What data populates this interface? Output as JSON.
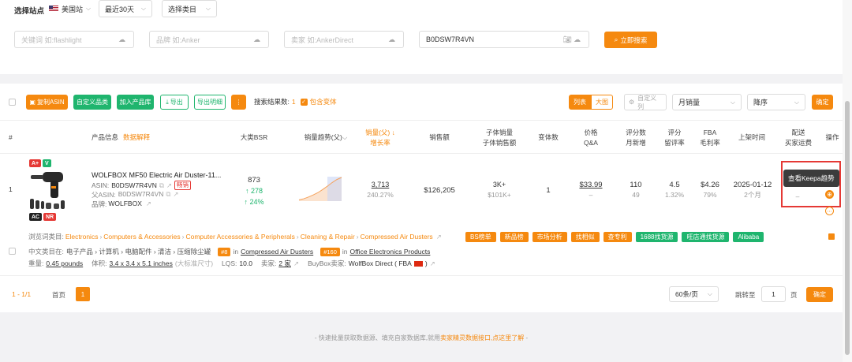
{
  "filters": {
    "site_label": "选择站点",
    "site_value": "美国站",
    "period_value": "最近30天",
    "category_placeholder": "选择类目",
    "keyword_placeholder": "关键词 如:flashlight",
    "brand_placeholder": "品牌 如:Anker",
    "seller_placeholder": "卖家 如:AnkerDirect",
    "asin_value": "B0DSW7R4VN",
    "search_button": "立即搜索"
  },
  "toolbar": {
    "copy_asin": "复制ASIN",
    "custom_category": "自定义品类",
    "add_library": "加入产品库",
    "export": "导出",
    "export_detail": "导出明细",
    "result_count_label": "搜索结果数:",
    "result_count": "1",
    "include_variants": "包含变体",
    "view_list": "列表",
    "view_grid": "大图",
    "custom_columns": "自定义列",
    "sort_field": "月销量",
    "sort_order": "降序",
    "confirm": "确定"
  },
  "columns": {
    "num": "#",
    "product": "产品信息",
    "data_explain": "数据解释",
    "bsr": "大类BSR",
    "trend": "销量趋势(父)",
    "sales_line1": "销量(父)",
    "sales_line2": "增长率",
    "revenue": "销售额",
    "child_sales_line1": "子体销量",
    "child_sales_line2": "子体销售额",
    "variants": "变体数",
    "price_line1": "价格",
    "price_line2": "Q&A",
    "reviews_line1": "评分数",
    "reviews_line2": "月新增",
    "rating_line1": "评分",
    "rating_line2": "留评率",
    "fba_line1": "FBA",
    "fba_line2": "毛利率",
    "launch": "上架时间",
    "delivery_line1": "配送",
    "delivery_line2": "买家运费",
    "action": "操作"
  },
  "row": {
    "index": "1",
    "title": "WOLFBOX MF50 Electric Air Duster-11...",
    "asin_label": "ASIN:",
    "asin": "B0DSW7R4VN",
    "hot_tag": "畅销",
    "parent_asin_label": "父ASIN:",
    "parent_asin": "B0DSW7R4VN",
    "brand_label": "品牌:",
    "brand": "WOLFBOX",
    "badges": [
      "A+",
      "V",
      "AC",
      "NR"
    ],
    "bsr": "873",
    "bsr_change": "↑ 278",
    "bsr_pct": "↑ 24%",
    "sales": "3,713",
    "growth": "240.27%",
    "revenue": "$126,205",
    "child_sales": "3K+",
    "child_revenue": "$101K+",
    "variants": "1",
    "price": "$33.99",
    "qa": "–",
    "reviews": "110",
    "reviews_new": "49",
    "rating": "4.5",
    "review_rate": "1.32%",
    "fba": "$4.26",
    "margin": "79%",
    "launch_date": "2025-01-12",
    "launch_age": "2个月",
    "delivery_dash": "–",
    "trend_points": [
      5,
      9,
      16,
      24,
      33,
      45,
      58,
      72,
      84,
      92
    ]
  },
  "tooltip": {
    "text": "查看Keepa趋势"
  },
  "details": {
    "browse_label": "浏览词类目:",
    "browse_path": [
      "Electronics",
      "Computers & Accessories",
      "Computer Accessories & Peripherals",
      "Cleaning & Repair",
      "Compressed Air Dusters"
    ],
    "chips": [
      "BS榜单",
      "新品榜",
      "市场分析",
      "找相似",
      "查专利",
      "1688找货源",
      "旺店通找货源",
      "Alibaba"
    ],
    "cn_label": "中文类目在:",
    "cn_path": "电子产品 › 计算机 › 电脑配件 › 清洁 › 压缩除尘罐",
    "rank1": "#8",
    "rank1_in": "in",
    "rank1_cat": "Compressed Air Dusters",
    "rank2": "#160",
    "rank2_in": "in",
    "rank2_cat": "Office Electronics Products",
    "weight_label": "重量:",
    "weight": "0.45 pounds",
    "volume_label": "体积:",
    "volume": "3.4 x 3.4 x 5.1 inches",
    "volume_note": "(大标准尺寸)",
    "lqs_label": "LQS:",
    "lqs": "10.0",
    "seller_label": "卖家:",
    "seller_count": "2 家",
    "buybox_label": "BuyBox卖家:",
    "buybox": "WolfBox Direct ( FBA"
  },
  "pagination": {
    "range": "1 - 1/1",
    "first": "首页",
    "page": "1",
    "per_page": "60条/页",
    "goto_label": "跳转至",
    "goto_value": "1",
    "page_unit": "页",
    "confirm": "确定"
  },
  "footer": {
    "text_before": "- 快速批量获取数据源、填充自家数据库,就用",
    "link": "卖家精灵数据接口,点这里了解",
    "text_after": " -"
  },
  "colors": {
    "accent": "#f5890f",
    "green": "#1fb56e",
    "highlight_box": "#e53935"
  }
}
